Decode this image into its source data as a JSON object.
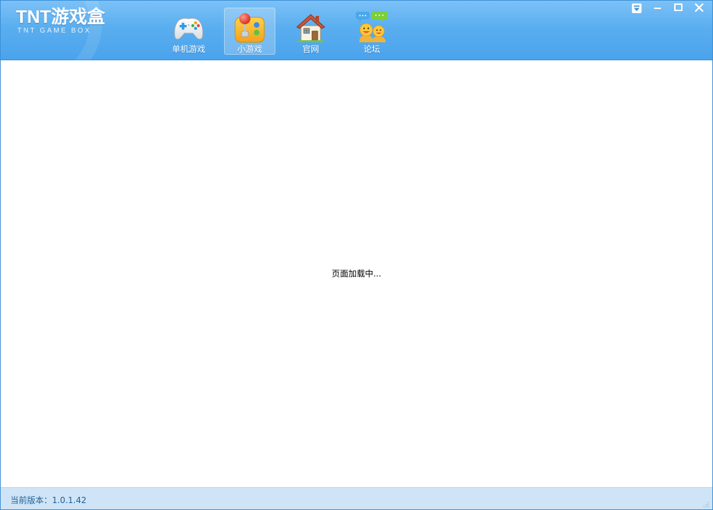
{
  "app": {
    "logo_main": "TNT游戏盒",
    "logo_sub": "TNT GAME BOX"
  },
  "nav": {
    "items": [
      {
        "label": "单机游戏",
        "icon": "gamepad-icon",
        "active": false
      },
      {
        "label": "小游戏",
        "icon": "joystick-icon",
        "active": true
      },
      {
        "label": "官网",
        "icon": "house-icon",
        "active": false
      },
      {
        "label": "论坛",
        "icon": "forum-chat-icon",
        "active": false
      }
    ]
  },
  "window_controls": {
    "menu_icon": "dropdown-menu-icon",
    "minimize_icon": "minimize-icon",
    "maximize_icon": "maximize-icon",
    "close_icon": "close-icon"
  },
  "content": {
    "loading_text": "页面加载中..."
  },
  "status": {
    "version_text": "当前版本：1.0.1.42"
  },
  "colors": {
    "titlebar": "#5aaeef",
    "statusbar": "#cfe4f6",
    "status_text": "#1f5f98"
  }
}
